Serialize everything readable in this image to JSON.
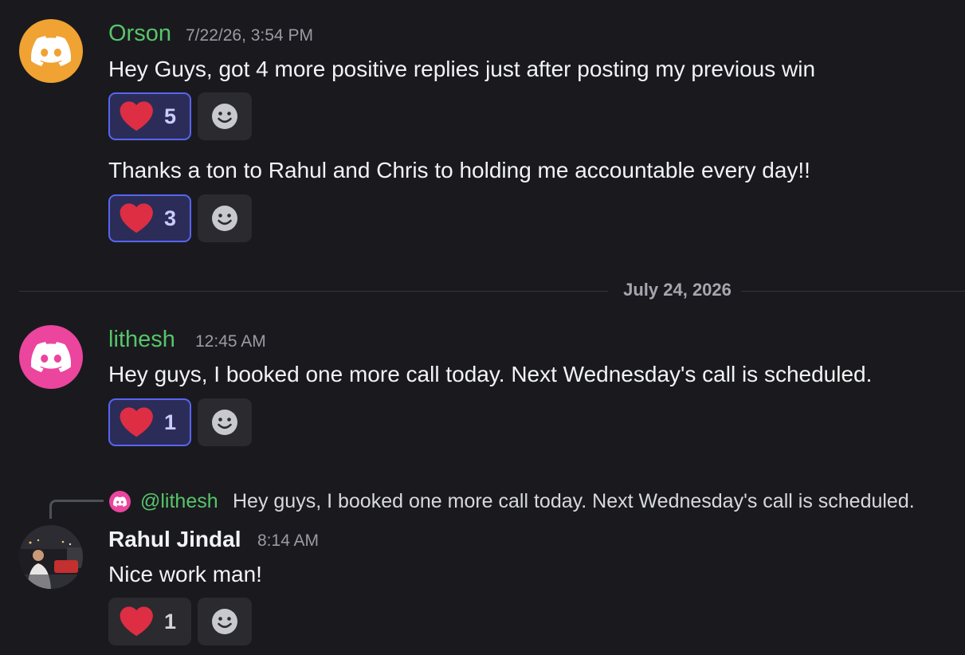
{
  "colors": {
    "accent": "#5865f2",
    "username_green": "#57c46b",
    "orson_avatar_bg": "#f0a232",
    "lithesh_avatar_bg": "#eb459e",
    "heart": "#dd2e44",
    "background": "#1a1a1e"
  },
  "messages": [
    {
      "author": "Orson",
      "timestamp": "7/22/26, 3:54 PM",
      "avatar_icon": "discord-logo-icon",
      "lines": [
        {
          "text": "Hey Guys, got 4 more positive replies just after posting my previous win",
          "reaction": {
            "emoji": "heart-icon",
            "count": "5",
            "active": true
          }
        },
        {
          "text": "Thanks a ton to Rahul and Chris to holding me accountable every day!!",
          "reaction": {
            "emoji": "heart-icon",
            "count": "3",
            "active": true
          }
        }
      ]
    },
    {
      "author": "lithesh",
      "timestamp": "12:45 AM",
      "avatar_icon": "discord-logo-icon",
      "lines": [
        {
          "text": "Hey guys, I booked one more call today. Next Wednesday's call is scheduled.",
          "reaction": {
            "emoji": "heart-icon",
            "count": "1",
            "active": true
          }
        }
      ]
    },
    {
      "author": "Rahul Jindal",
      "timestamp": "8:14 AM",
      "avatar_icon": "user-photo",
      "reply_to": {
        "mention": "@lithesh",
        "text": "Hey guys, I booked one more call today. Next Wednesday's call is scheduled."
      },
      "lines": [
        {
          "text": "Nice work man!",
          "reaction": {
            "emoji": "heart-icon",
            "count": "1",
            "active": false
          }
        }
      ]
    }
  ],
  "date_divider": "July 24, 2026",
  "add_reaction_icon": "smiley-add-reaction-icon"
}
